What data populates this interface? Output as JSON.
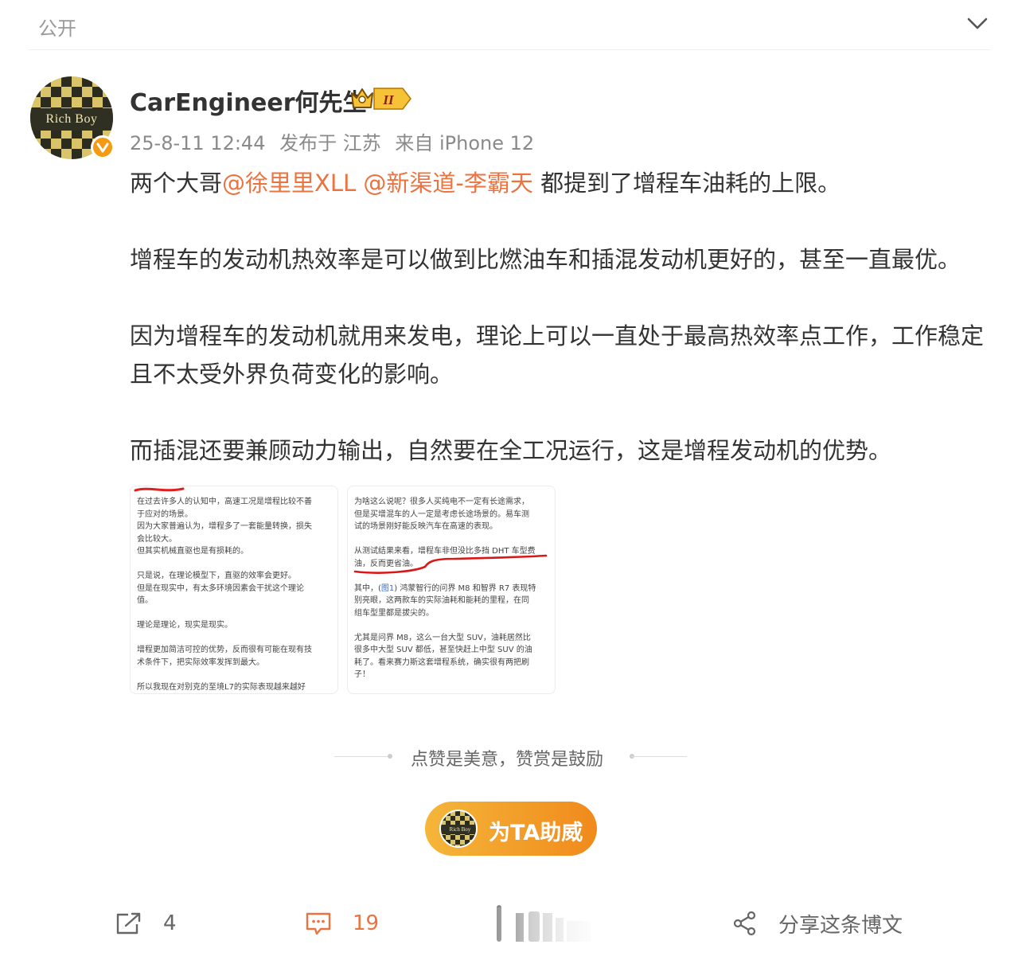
{
  "header": {
    "visibility_label": "公开"
  },
  "author": {
    "avatar_text": "Rich Boy",
    "name": "CarEngineer何先生",
    "level": "II",
    "timestamp": "25-8-11 12:44",
    "location": "发布于 江苏",
    "source": "来自 iPhone 12"
  },
  "post": {
    "intro_before": "两个大哥",
    "mention_1": "@徐里里XLL",
    "mention_2": "@新渠道-李霸天",
    "intro_after": " 都提到了增程车油耗的上限。",
    "para_2": "增程车的发动机热效率是可以做到比燃油车和插混发动机更好的，甚至一直最优。",
    "para_3": "因为增程车的发动机就用来发电，理论上可以一直处于最高热效率点工作，工作稳定且不太受外界负荷变化的影响。",
    "para_4": "而插混还要兼顾动力输出，自然要在全工况运行，这是增程发动机的优势。"
  },
  "images": [
    {
      "lines": [
        "在过去许多人的认知中，高速工况是增程比较不善",
        "于应对的场景。",
        "因为大家普遍认为，增程多了一套能量转换，损失",
        "会比较大。",
        "但其实机械直驱也是有损耗的。",
        "",
        "只是说，在理论模型下，直驱的效率会更好。",
        "但是在现实中，有太多环境因素会干扰这个理论",
        "值。",
        "",
        "理论是理论，现实是现实。",
        "",
        "增程更加简洁可控的优势，反而很有可能在现有技",
        "术条件下，把实际效率发挥到最大。",
        "",
        "所以我现在对别克的至境L7的实际表现越来越好"
      ]
    },
    {
      "lines_a": [
        "为啥这么说呢？很多人买纯电不一定有长途需求，",
        "但是买增混车的人一定是考虑长途场景的。易车测",
        "试的场景刚好能反映汽车在高速的表现。",
        "",
        "从测试结果来看，增程车非但没比多挡 DHT 车型费",
        "油，反而更省油。",
        ""
      ],
      "line_b_before": "其中，(",
      "line_b_ref": "图1",
      "line_b_after": ") 鸿蒙智行的问界 M8 和智界 R7 表现特",
      "lines_c": [
        "别亮眼，这两款车的实际油耗和能耗的里程，在同",
        "组车型里都是拔尖的。",
        "",
        "尤其是问界 M8，这么一台大型 SUV，油耗居然比",
        "很多中大型 SUV 都低，甚至快赶上中型 SUV 的油",
        "耗了。看来赛力斯这套增程系统，确实很有两把刷",
        "子！"
      ]
    }
  ],
  "reward": {
    "slogan": "点赞是美意，赞赏是鼓励",
    "button_label": "为TA助威"
  },
  "footer": {
    "repost_count": "4",
    "comment_count": "19",
    "share_label": "分享这条博文"
  },
  "colors": {
    "mention": "#eb7340",
    "badge": "#f59a12",
    "cheer_gradient_start": "#f5b63a",
    "cheer_gradient_end": "#f08a1c"
  }
}
